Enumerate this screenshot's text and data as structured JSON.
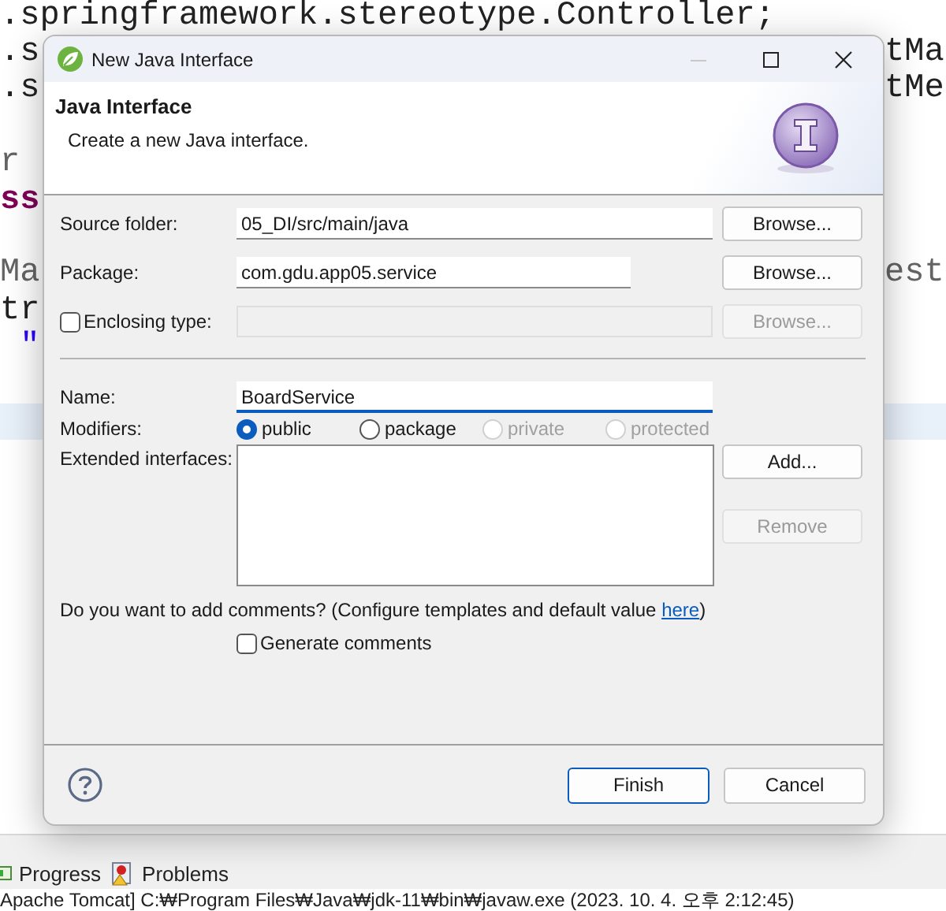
{
  "editor": {
    "lines": [
      {
        "kind": "plain",
        "left": ".springframework.stereotype.Controller;"
      },
      {
        "kind": "plain",
        "left": ".s",
        "right": "tMa"
      },
      {
        "kind": "plain",
        "left": ".s",
        "right": "tMe"
      },
      {
        "kind": "blank"
      },
      {
        "kind": "annotation",
        "left": "r"
      },
      {
        "kind": "keyword",
        "left": "ss"
      },
      {
        "kind": "blank"
      },
      {
        "kind": "annotation",
        "left": "Ma",
        "right": "est"
      },
      {
        "kind": "plain",
        "left": "tr"
      },
      {
        "kind": "string",
        "left": " \""
      },
      {
        "kind": "blank"
      },
      {
        "kind": "current"
      }
    ]
  },
  "dialog": {
    "title": "New Java Interface",
    "header": {
      "title": "Java Interface",
      "description": "Create a new Java interface."
    },
    "location_rows": [
      {
        "kind": "text",
        "label": "Source folder:",
        "value": "05_DI/src/main/java",
        "button": {
          "label": "Browse...",
          "disabled": false
        }
      },
      {
        "kind": "text",
        "label": "Package:",
        "value": "com.gdu.app05.service",
        "button": {
          "label": "Browse...",
          "disabled": false
        }
      },
      {
        "kind": "check",
        "label": "Enclosing type:",
        "checked": false,
        "button": {
          "label": "Browse...",
          "disabled": true
        }
      }
    ],
    "name": {
      "label": "Name:",
      "value": "BoardService",
      "focused": true
    },
    "modifiers": {
      "label": "Modifiers:",
      "options": [
        {
          "label": "public",
          "selected": true,
          "disabled": false
        },
        {
          "label": "package",
          "selected": false,
          "disabled": false
        },
        {
          "label": "private",
          "selected": false,
          "disabled": true
        },
        {
          "label": "protected",
          "selected": false,
          "disabled": true
        }
      ]
    },
    "extended": {
      "label": "Extended interfaces:",
      "buttons": [
        {
          "label": "Add...",
          "disabled": false
        },
        {
          "label": "Remove",
          "disabled": true
        }
      ]
    },
    "comments": {
      "text": "Do you want to add comments? (Configure templates and default value ",
      "link": "here",
      "after": ")"
    },
    "generate": {
      "label": "Generate comments",
      "checked": false
    },
    "buttons": [
      {
        "label": "Finish",
        "default": true
      },
      {
        "label": "Cancel",
        "default": false
      }
    ]
  },
  "bottom": {
    "tabs": [
      {
        "label": "Progress",
        "kind": "progress"
      },
      {
        "label": "Problems",
        "kind": "problems"
      }
    ],
    "console": "Apache Tomcat] C:₩Program Files₩Java₩jdk-11₩bin₩javaw.exe  (2023. 10. 4. 오후 2:12:45)"
  }
}
